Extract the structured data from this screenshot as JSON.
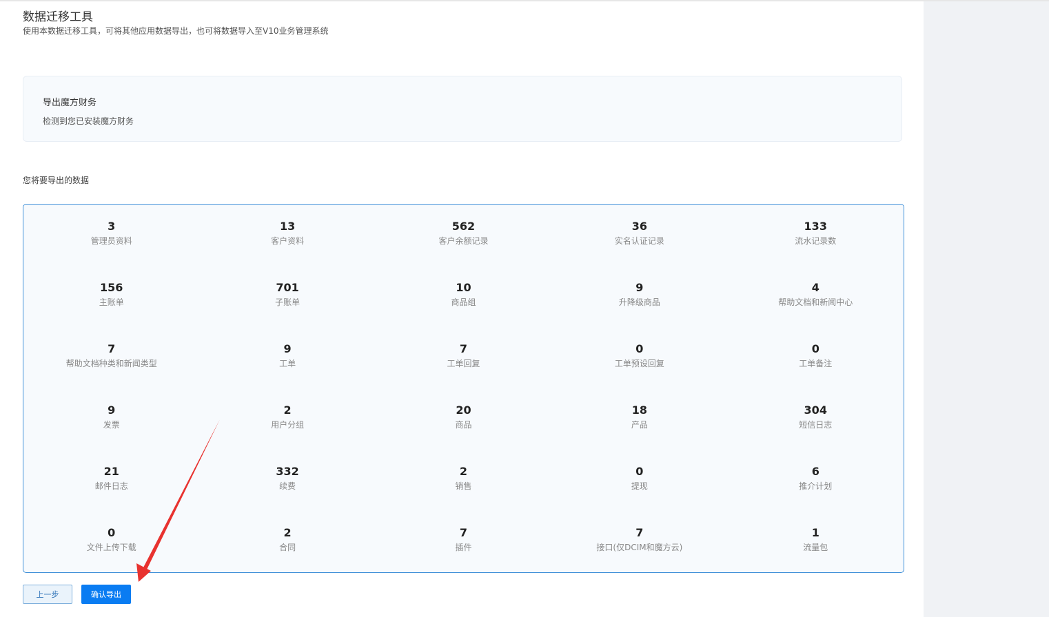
{
  "header": {
    "title": "数据迁移工具",
    "subtitle": "使用本数据迁移工具，可将其他应用数据导出，也可将数据导入至V10业务管理系统"
  },
  "info": {
    "title": "导出魔方财务",
    "description": "检测到您已安装魔方财务"
  },
  "section_label": "您将要导出的数据",
  "stats": [
    {
      "value": "3",
      "label": "管理员资料"
    },
    {
      "value": "13",
      "label": "客户资料"
    },
    {
      "value": "562",
      "label": "客户余额记录"
    },
    {
      "value": "36",
      "label": "实名认证记录"
    },
    {
      "value": "133",
      "label": "流水记录数"
    },
    {
      "value": "156",
      "label": "主账单"
    },
    {
      "value": "701",
      "label": "子账单"
    },
    {
      "value": "10",
      "label": "商品组"
    },
    {
      "value": "9",
      "label": "升降级商品"
    },
    {
      "value": "4",
      "label": "帮助文档和新闻中心"
    },
    {
      "value": "7",
      "label": "帮助文档种类和新闻类型"
    },
    {
      "value": "9",
      "label": "工单"
    },
    {
      "value": "7",
      "label": "工单回复"
    },
    {
      "value": "0",
      "label": "工单预设回复"
    },
    {
      "value": "0",
      "label": "工单备注"
    },
    {
      "value": "9",
      "label": "发票"
    },
    {
      "value": "2",
      "label": "用户分组"
    },
    {
      "value": "20",
      "label": "商品"
    },
    {
      "value": "18",
      "label": "产品"
    },
    {
      "value": "304",
      "label": "短信日志"
    },
    {
      "value": "21",
      "label": "邮件日志"
    },
    {
      "value": "332",
      "label": "续费"
    },
    {
      "value": "2",
      "label": "销售"
    },
    {
      "value": "0",
      "label": "提现"
    },
    {
      "value": "6",
      "label": "推介计划"
    },
    {
      "value": "0",
      "label": "文件上传下载"
    },
    {
      "value": "2",
      "label": "合同"
    },
    {
      "value": "7",
      "label": "插件"
    },
    {
      "value": "7",
      "label": "接口(仅DCIM和魔方云)"
    },
    {
      "value": "1",
      "label": "流量包"
    }
  ],
  "buttons": {
    "prev_label": "上一步",
    "confirm_label": "确认导出"
  },
  "colors": {
    "accent": "#0a7cf2",
    "border_blue": "#3d8fd8",
    "annotation_arrow": "#e8322f"
  }
}
